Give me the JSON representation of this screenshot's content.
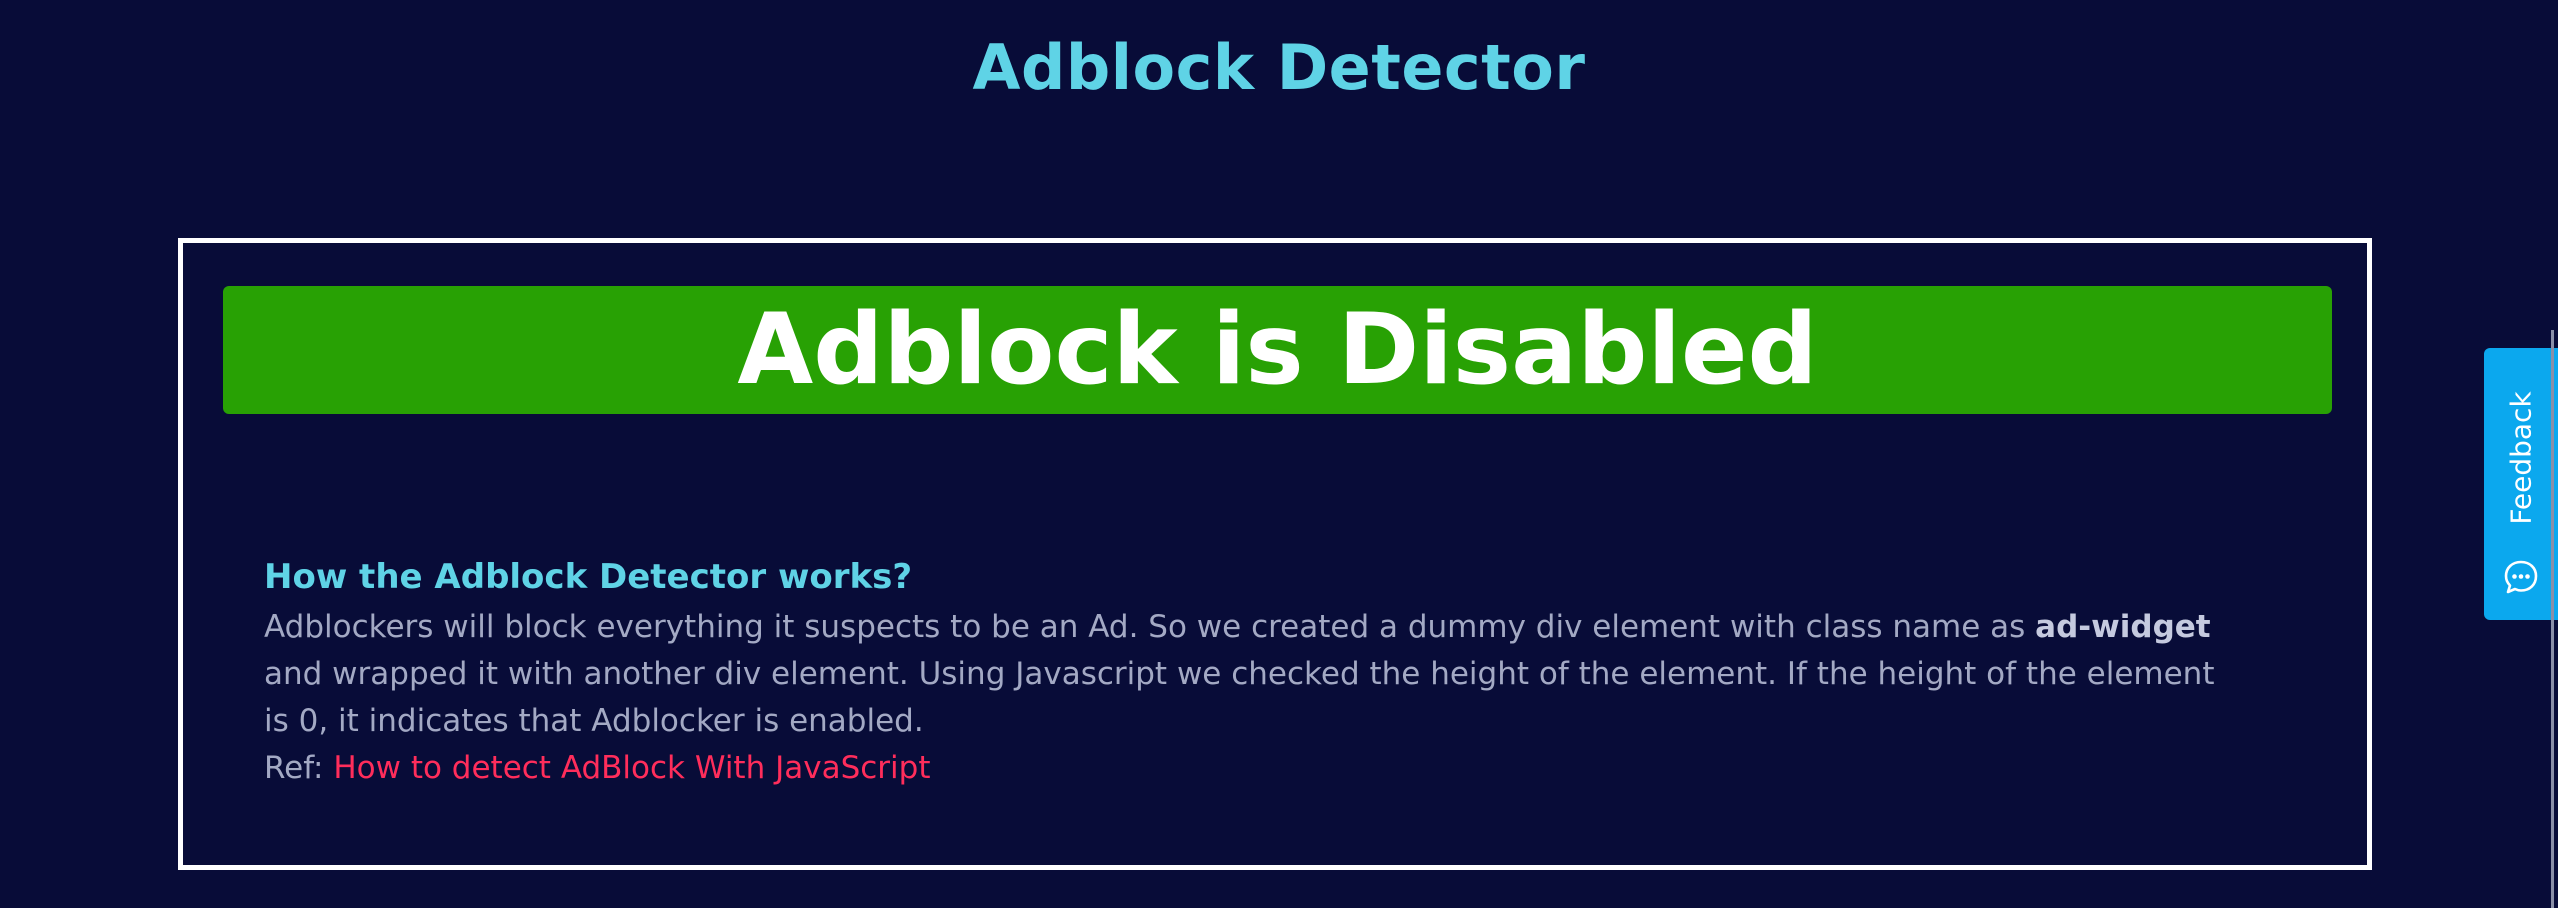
{
  "header": {
    "title": "Adblock Detector"
  },
  "status": {
    "text": "Adblock is Disabled",
    "color": "#28a104"
  },
  "info": {
    "heading": "How the Adblock Detector works?",
    "text_before": "Adblockers will block everything it suspects to be an Ad. So we created a dummy div element with class name as ",
    "class_name": "ad-widget",
    "text_after": " and wrapped it with another div element. Using Javascript we checked the height of the element. If the height of the element is 0, it indicates that Adblocker is enabled.",
    "ref_label": "Ref: ",
    "ref_link_text": "How to detect AdBlock With JavaScript"
  },
  "feedback": {
    "label": "Feedback",
    "icon": "chat-bubble-icon"
  },
  "colors": {
    "background": "#080c38",
    "accent": "#5fd3e6",
    "link": "#ff2d5b",
    "feedback": "#0ba8ee"
  }
}
